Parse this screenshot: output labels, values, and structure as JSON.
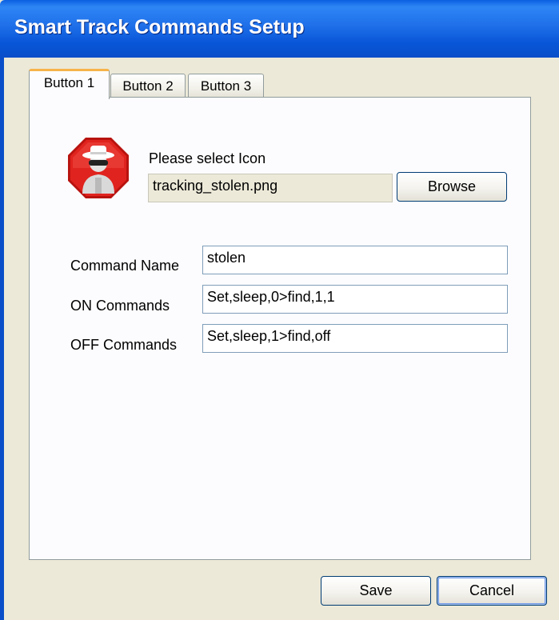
{
  "window": {
    "title": "Smart Track Commands Setup"
  },
  "tabs": [
    {
      "label": "Button 1",
      "active": true
    },
    {
      "label": "Button 2",
      "active": false
    },
    {
      "label": "Button 3",
      "active": false
    }
  ],
  "icon_section": {
    "icon": "spy-thief-icon",
    "prompt": "Please select Icon",
    "file_value": "tracking_stolen.png",
    "browse_label": "Browse"
  },
  "form": {
    "command_name_label": "Command Name",
    "command_name_value": "stolen",
    "on_commands_label": "ON Commands",
    "on_commands_value": "Set,sleep,0>find,1,1",
    "off_commands_label": "OFF Commands",
    "off_commands_value": "Set,sleep,1>find,off"
  },
  "footer": {
    "save_label": "Save",
    "cancel_label": "Cancel"
  },
  "colors": {
    "titlebar": "#0a5fe0",
    "dialog_bg": "#ece9d8",
    "icon_red": "#e0231e",
    "tab_accent": "#f7b34a"
  }
}
